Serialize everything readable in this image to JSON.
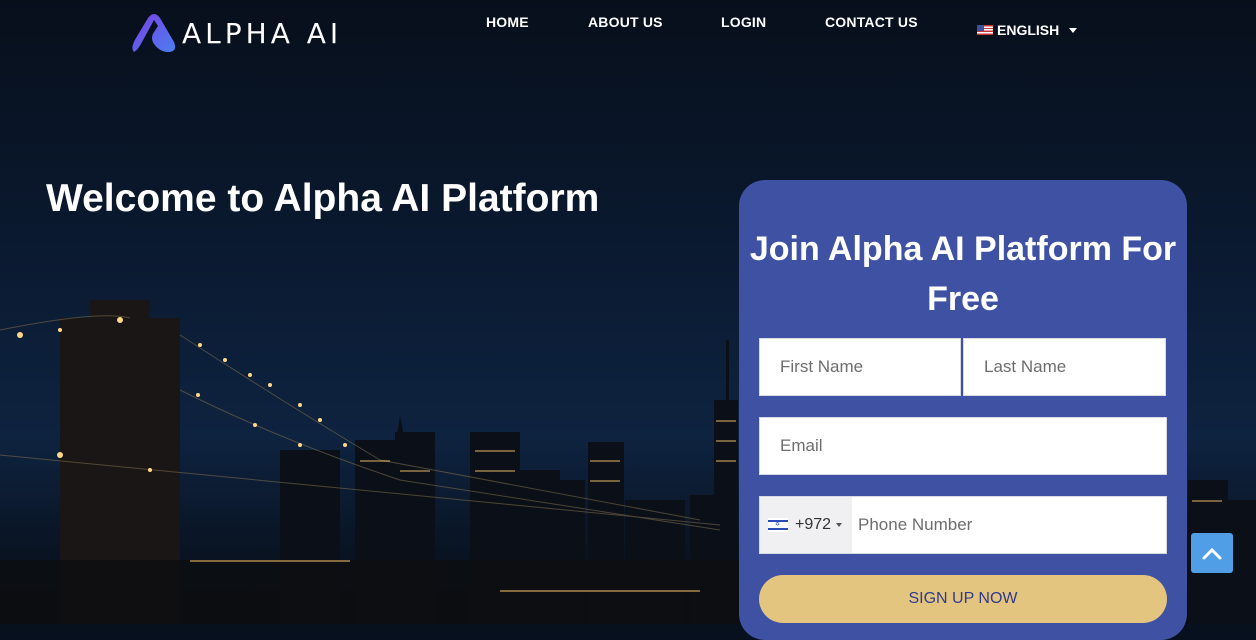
{
  "brand": {
    "name": "ALPHA AI",
    "logo_icon": "alpha-a-logo-icon",
    "logo_gradient": [
      "#7b3fe4",
      "#4a7ff0"
    ]
  },
  "nav": {
    "items": [
      {
        "label": "HOME"
      },
      {
        "label": "ABOUT US"
      },
      {
        "label": "LOGIN"
      },
      {
        "label": "CONTACT US"
      }
    ],
    "language": {
      "label": "ENGLISH",
      "flag_icon": "us-flag-icon"
    }
  },
  "hero": {
    "title": "Welcome to Alpha AI Platform"
  },
  "form": {
    "title": "Join Alpha AI Platform For Free",
    "first_name_placeholder": "First Name",
    "last_name_placeholder": "Last Name",
    "email_placeholder": "Email",
    "country_code": "+972",
    "country_flag_icon": "israel-flag-icon",
    "phone_placeholder": "Phone Number",
    "submit_label": "SIGN UP NOW"
  },
  "colors": {
    "card_bg": "#3f51a3",
    "button_bg": "#e3c57f",
    "button_text": "#2f3b8f",
    "scroll_top_bg": "#4f9ee6"
  },
  "scroll_top": {
    "icon": "chevron-up-icon"
  }
}
